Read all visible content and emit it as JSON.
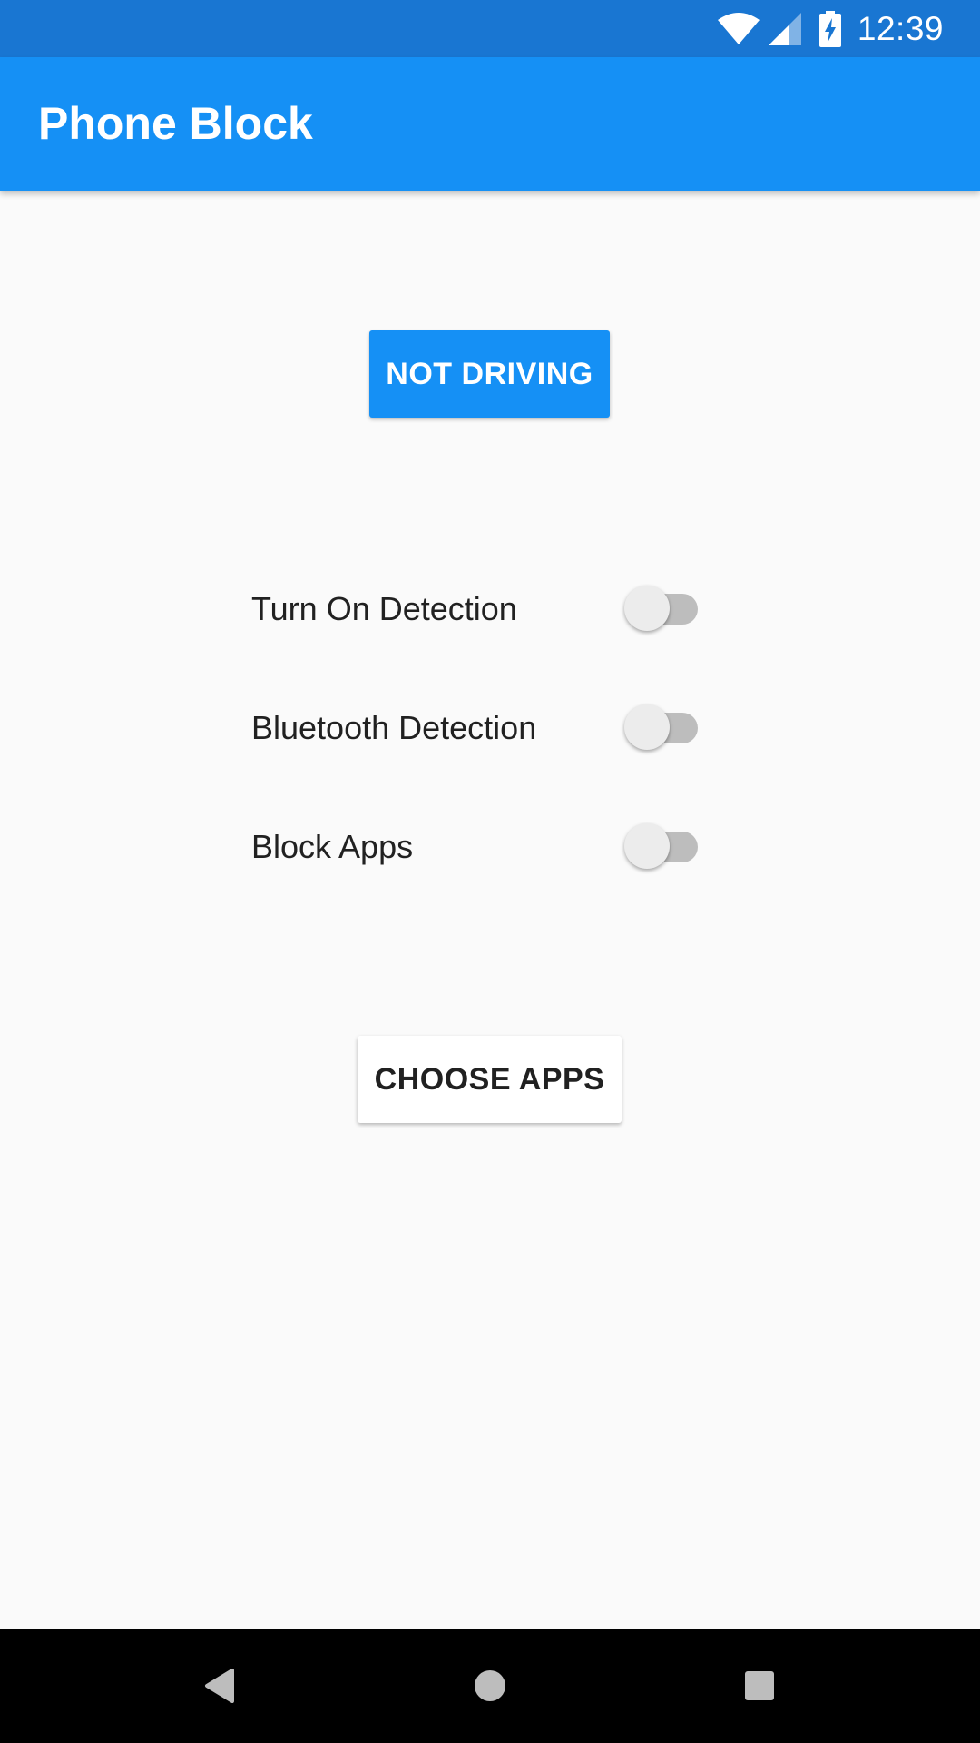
{
  "status_bar": {
    "time": "12:39",
    "icons": [
      "wifi-icon",
      "cell-signal-icon",
      "battery-charging-icon"
    ]
  },
  "app_bar": {
    "title": "Phone Block"
  },
  "main": {
    "driving_button_label": "NOT DRIVING",
    "settings": [
      {
        "label": "Turn On Detection",
        "checked": false
      },
      {
        "label": "Bluetooth Detection",
        "checked": false
      },
      {
        "label": "Block Apps",
        "checked": false
      }
    ],
    "choose_apps_label": "CHOOSE APPS"
  },
  "nav_bar": {
    "icons": [
      "back-icon",
      "home-icon",
      "recents-icon"
    ]
  },
  "colors": {
    "status_bar": "#1976d2",
    "primary": "#1590f5",
    "background": "#fafafa",
    "switch_track_off": "#bdbdbd",
    "switch_thumb_off": "#ececec",
    "nav_bar": "#000000"
  }
}
